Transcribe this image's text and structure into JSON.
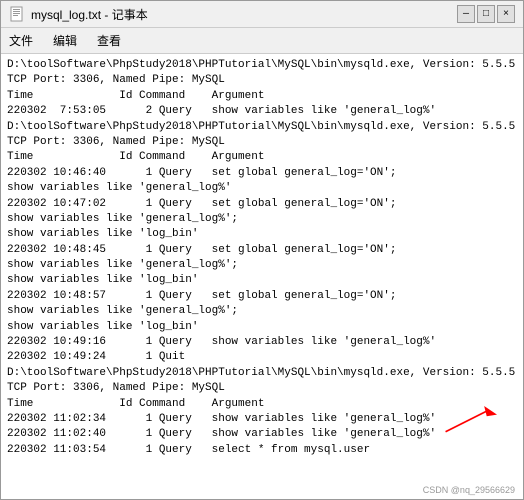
{
  "window": {
    "title": "mysql_log.txt - 记事本",
    "icon": "notepad"
  },
  "menu": {
    "items": [
      "文件",
      "编辑",
      "查看"
    ]
  },
  "content": {
    "lines": [
      "D:\\toolSoftware\\PhpStudy2018\\PHPTutorial\\MySQL\\bin\\mysqld.exe, Version: 5.5.5",
      "TCP Port: 3306, Named Pipe: MySQL",
      "Time             Id Command    Argument",
      "220302  7:53:05      2 Query   show variables like 'general_log%'",
      "D:\\toolSoftware\\PhpStudy2018\\PHPTutorial\\MySQL\\bin\\mysqld.exe, Version: 5.5.5",
      "TCP Port: 3306, Named Pipe: MySQL",
      "Time             Id Command    Argument",
      "220302 10:46:40      1 Query   set global general_log='ON';",
      "show variables like 'general_log%'",
      "220302 10:47:02      1 Query   set global general_log='ON';",
      "show variables like 'general_log%';",
      "show variables like 'log_bin'",
      "220302 10:48:45      1 Query   set global general_log='ON';",
      "show variables like 'general_log%';",
      "show variables like 'log_bin'",
      "220302 10:48:57      1 Query   set global general_log='ON';",
      "show variables like 'general_log%';",
      "show variables like 'log_bin'",
      "220302 10:49:16      1 Query   show variables like 'general_log%'",
      "220302 10:49:24      1 Quit",
      "D:\\toolSoftware\\PhpStudy2018\\PHPTutorial\\MySQL\\bin\\mysqld.exe, Version: 5.5.5",
      "TCP Port: 3306, Named Pipe: MySQL",
      "Time             Id Command    Argument",
      "220302 11:02:34      1 Query   show variables like 'general_log%'",
      "220302 11:02:40      1 Query   show variables like 'general_log%'",
      "220302 11:03:54      1 Query   select * from mysql.user"
    ]
  },
  "watermark": "CSDN @nq_29566629",
  "controls": {
    "minimize": "—",
    "maximize": "□",
    "close": "×"
  }
}
